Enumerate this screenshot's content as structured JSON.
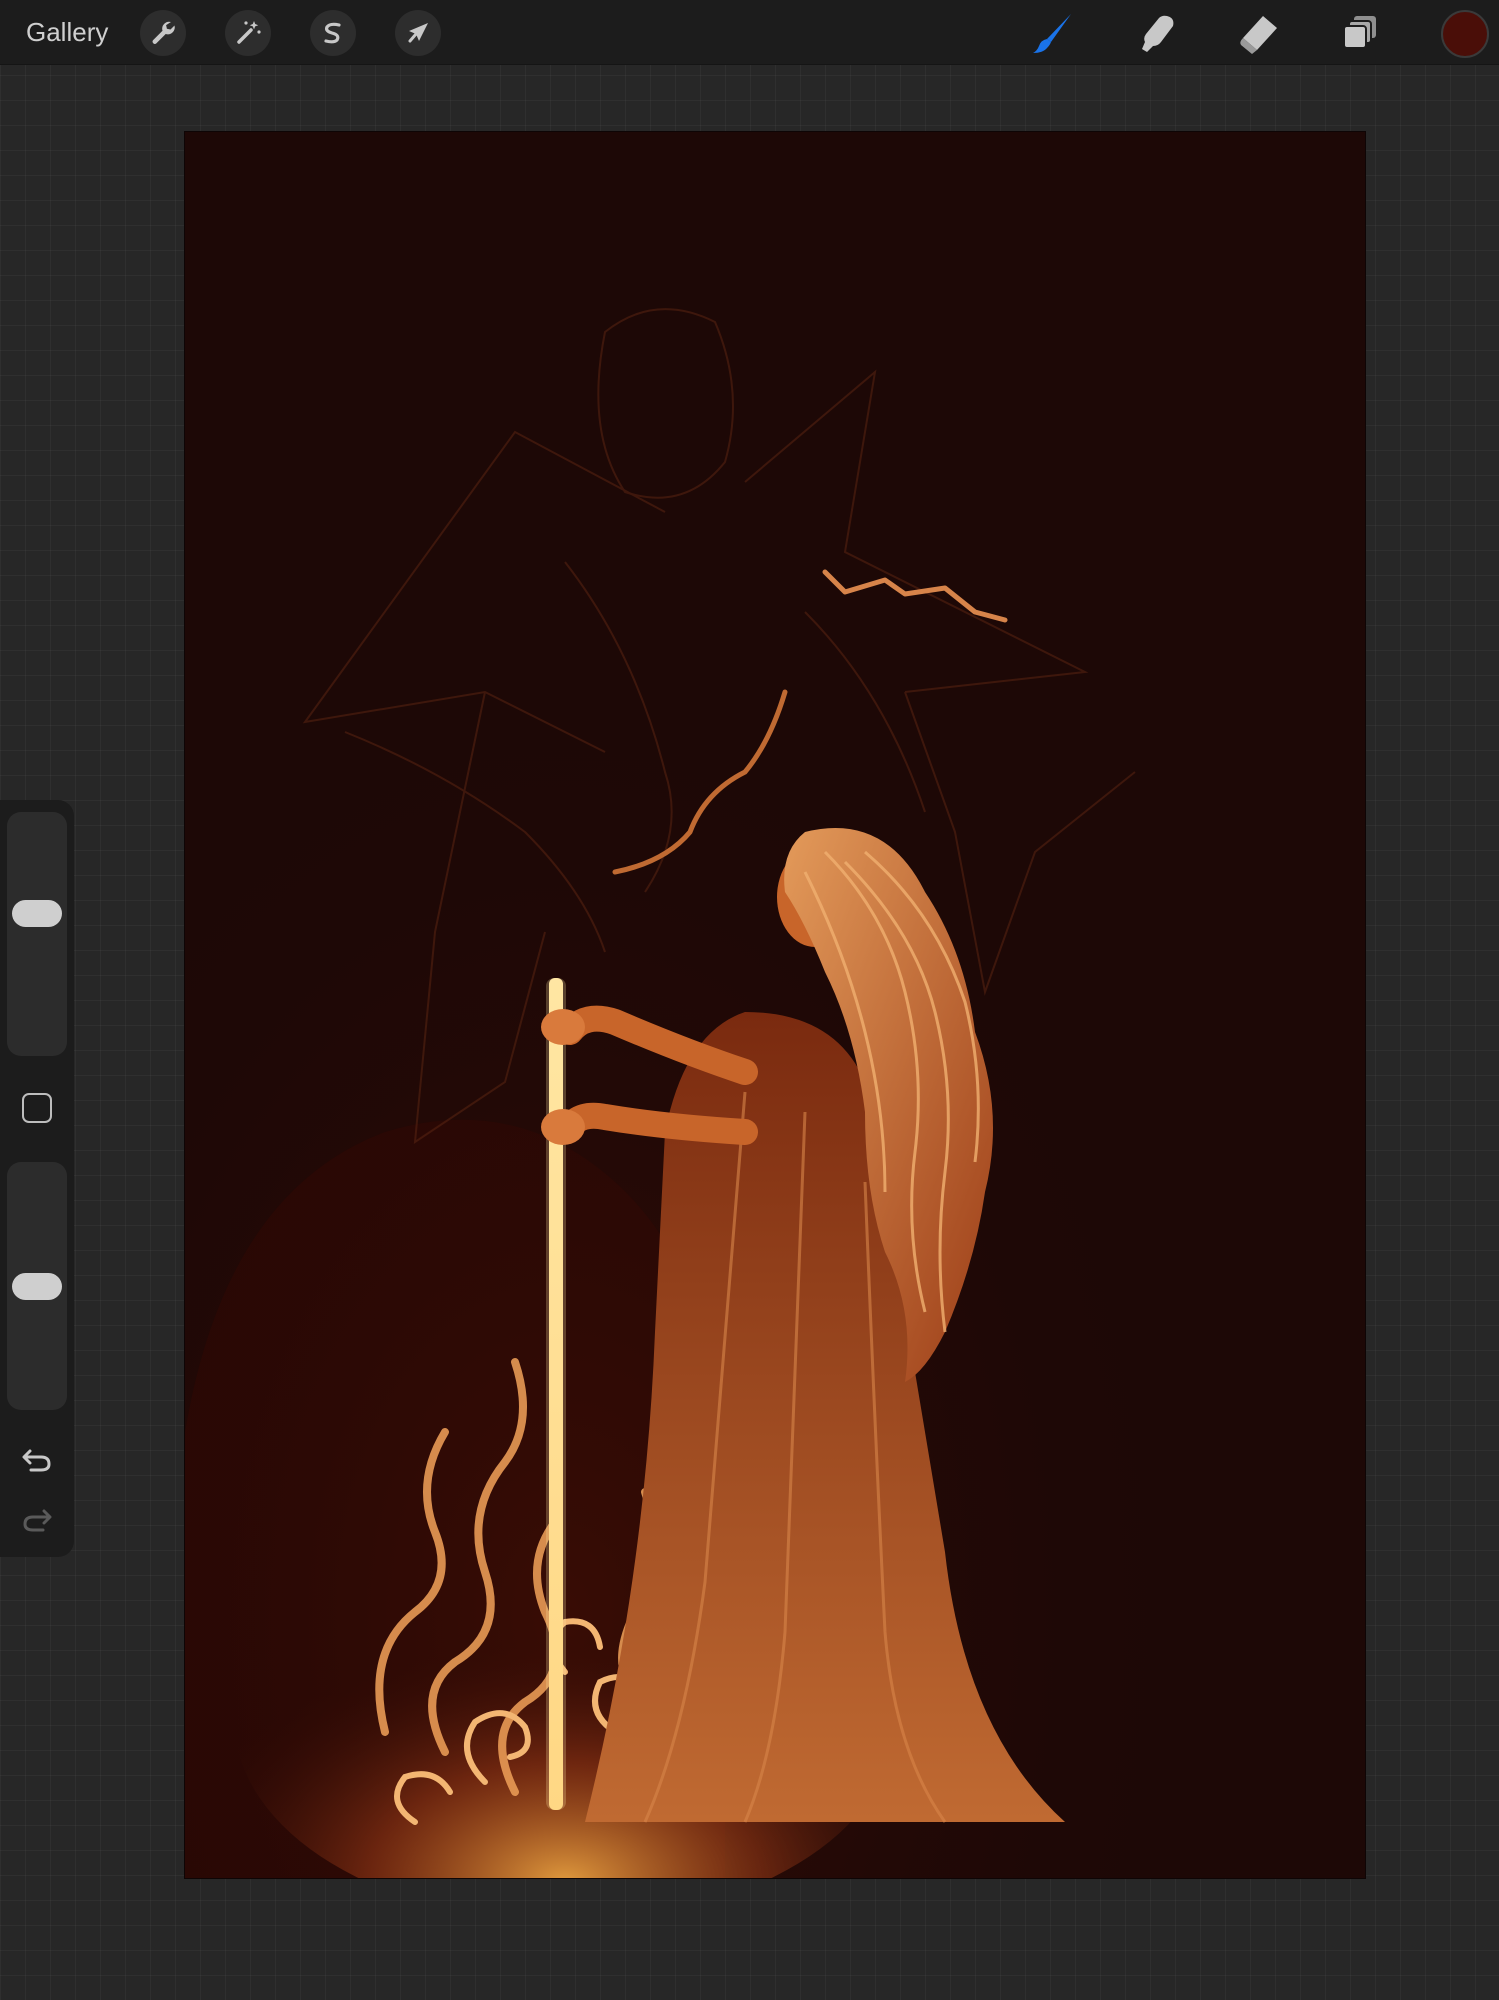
{
  "toolbar": {
    "gallery_label": "Gallery",
    "left_tools": [
      {
        "name": "actions",
        "icon": "wrench-icon"
      },
      {
        "name": "adjustments",
        "icon": "magic-wand-icon"
      },
      {
        "name": "selection",
        "icon": "selection-s-icon"
      },
      {
        "name": "transform",
        "icon": "arrow-cursor-icon"
      }
    ],
    "right_tools": [
      {
        "name": "paint",
        "icon": "brush-icon",
        "active": true
      },
      {
        "name": "smudge",
        "icon": "smudge-finger-icon",
        "active": false
      },
      {
        "name": "erase",
        "icon": "eraser-icon",
        "active": false
      },
      {
        "name": "layers",
        "icon": "layers-icon",
        "active": false
      }
    ],
    "current_color": "#4a0e08",
    "active_tool_color": "#1a73e8"
  },
  "sidebar": {
    "brush_size_level": 0.6,
    "brush_opacity_level": 0.5,
    "modify_icon": "square-icon",
    "undo_icon": "undo-icon",
    "redo_icon": "redo-icon"
  },
  "canvas": {
    "background_color": "#1d0806",
    "glow_color": "#ffe6a3",
    "figure_color": "#c8652a"
  }
}
